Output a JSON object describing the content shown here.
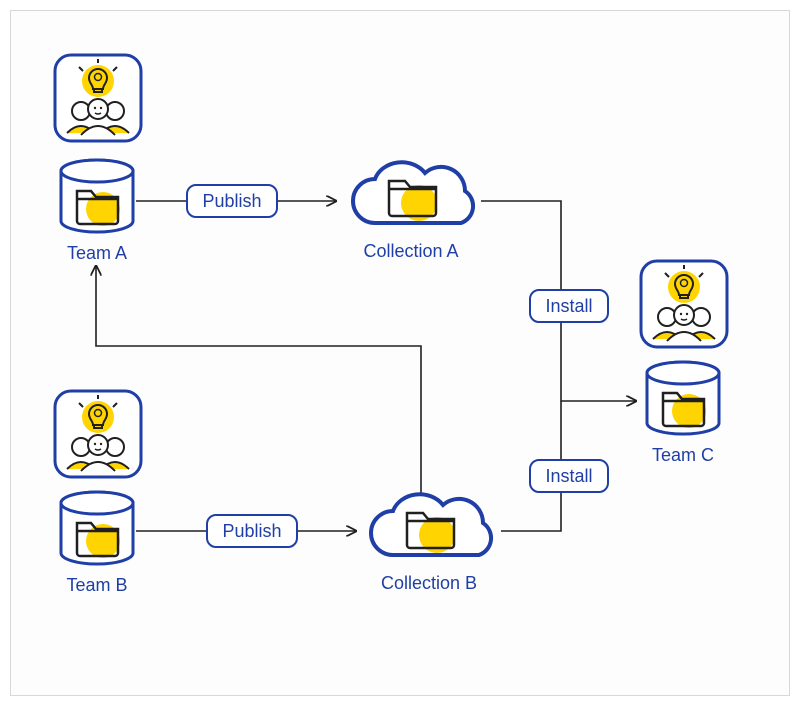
{
  "diagram": {
    "nodes": {
      "teamA": {
        "label": "Team A"
      },
      "teamB": {
        "label": "Team B"
      },
      "teamC": {
        "label": "Team C"
      },
      "collectionA": {
        "label": "Collection A"
      },
      "collectionB": {
        "label": "Collection B"
      }
    },
    "edges": {
      "publishA": {
        "label": "Publish"
      },
      "publishB": {
        "label": "Publish"
      },
      "installA": {
        "label": "Install"
      },
      "installB": {
        "label": "Install"
      }
    },
    "colors": {
      "stroke": "#1f3fa6",
      "accent": "#ffd400",
      "connector": "#202020"
    }
  }
}
